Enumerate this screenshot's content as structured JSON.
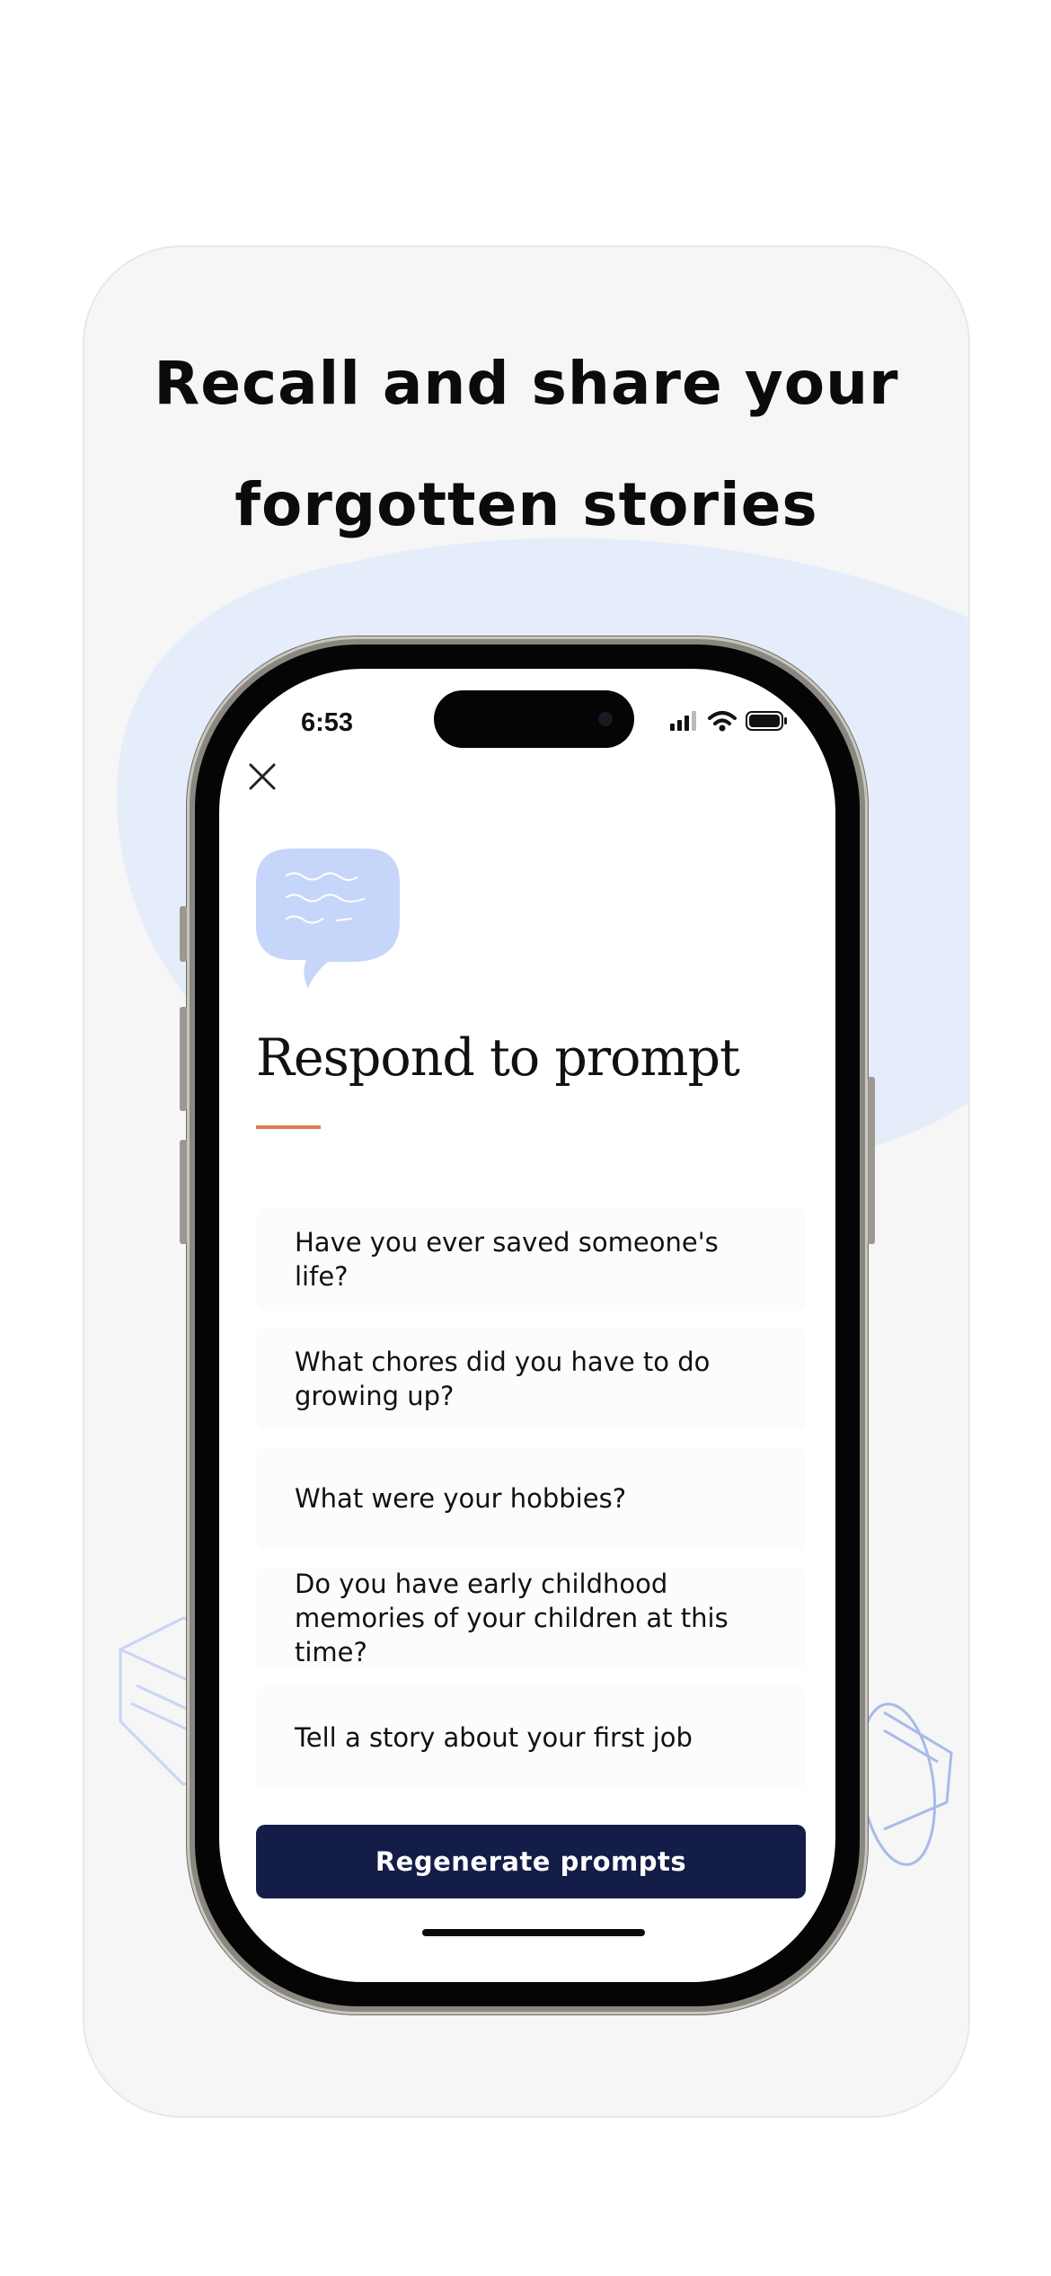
{
  "headline": {
    "line1": "Recall and share your",
    "line2": "forgotten stories"
  },
  "status_bar": {
    "time": "6:53"
  },
  "screen": {
    "title": "Respond to prompt",
    "prompts": [
      {
        "text": "Have you ever saved someone's life?"
      },
      {
        "text": "What chores did you have to do growing up?"
      },
      {
        "text": "What were your hobbies?"
      },
      {
        "text": "Do you have early childhood memories of your children at this time?"
      },
      {
        "text": "Tell a story about your first job"
      }
    ],
    "regenerate_label": "Regenerate prompts"
  },
  "colors": {
    "accent_orange": "#e07b4f",
    "button_navy": "#141c48",
    "blob_blue": "#e6edfa",
    "bubble_blue": "#c6d6fb"
  }
}
